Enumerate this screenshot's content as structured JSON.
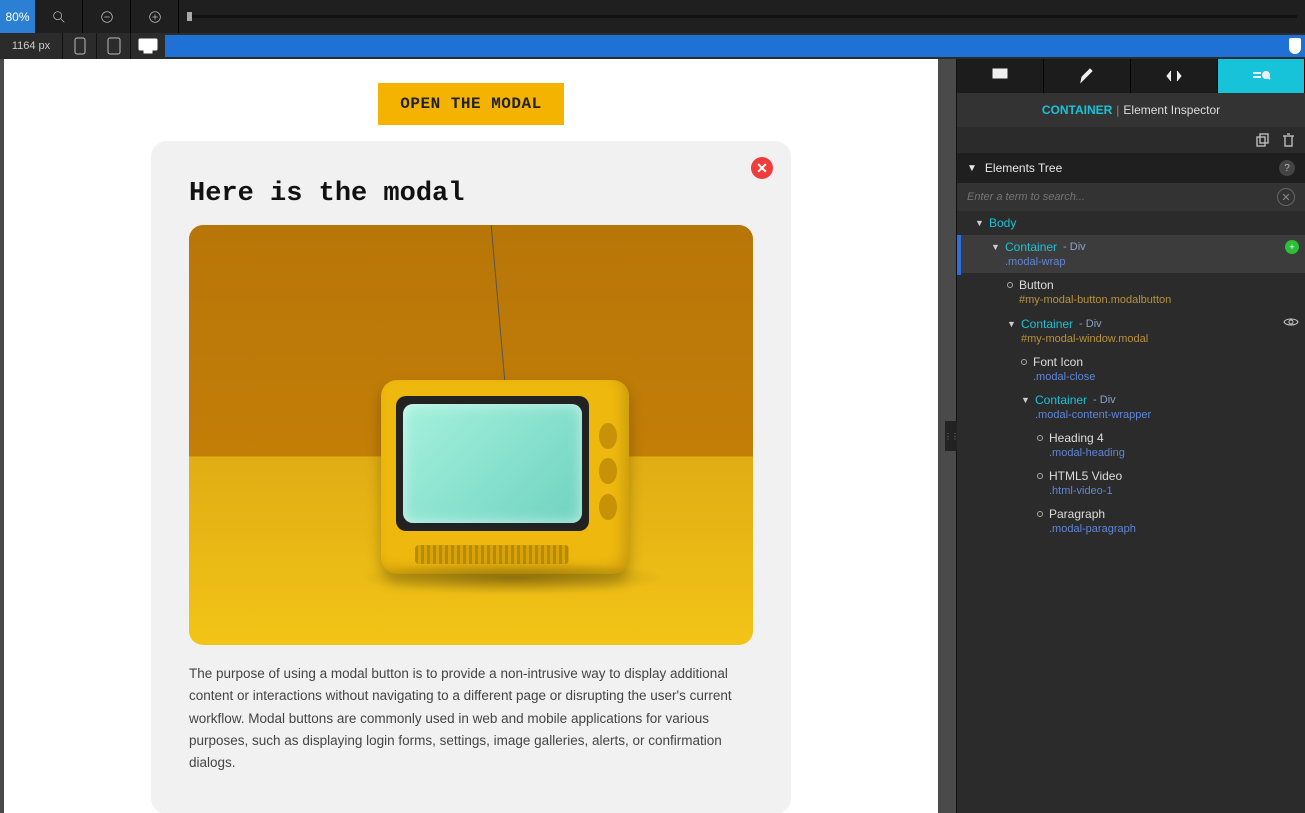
{
  "toolbar": {
    "zoom_label": "80%",
    "width_label": "1164 px"
  },
  "canvas": {
    "open_button": "OPEN THE MODAL",
    "modal_heading": "Here is the modal",
    "modal_paragraph": "The purpose of using a modal button is to provide a non-intrusive way to display additional content or interactions without navigating to a different page or disrupting the user's current workflow. Modal buttons are commonly used in web and mobile applications for various purposes, such as displaying login forms, settings, image galleries, alerts, or confirmation dialogs."
  },
  "inspector": {
    "header_left": "CONTAINER",
    "header_right": "Element Inspector",
    "tree_title": "Elements Tree",
    "search_placeholder": "Enter a term to search...",
    "body_label": "Body",
    "nodes": {
      "container_label": "Container",
      "div_type": " - Div",
      "modal_wrap": ".modal-wrap",
      "button_label": "Button",
      "button_sub": "#my-modal-button.modalbutton",
      "modal_window_sub": "#my-modal-window.modal",
      "font_icon": "Font Icon",
      "modal_close": ".modal-close",
      "content_wrapper": ".modal-content-wrapper",
      "heading4": "Heading 4",
      "modal_heading": ".modal-heading",
      "html5video": "HTML5 Video",
      "html_video_1": ".html-video-1",
      "paragraph_label": "Paragraph",
      "modal_paragraph": ".modal-paragraph"
    }
  }
}
